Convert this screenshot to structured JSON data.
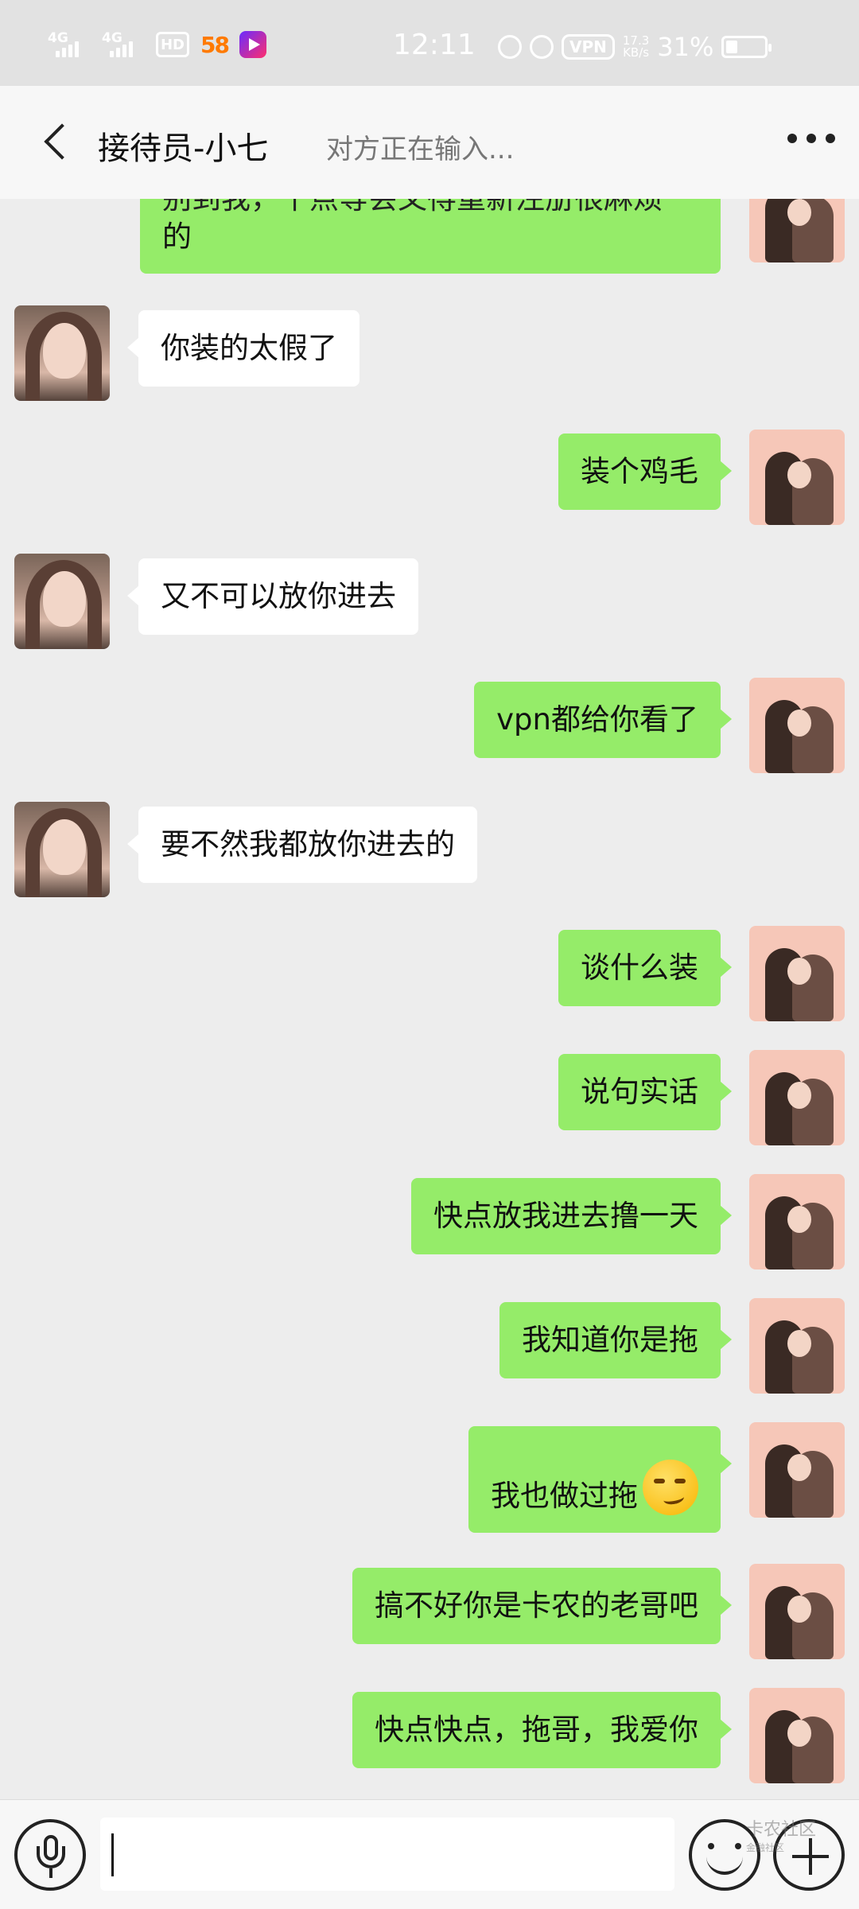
{
  "status_bar": {
    "signal_1": "4G",
    "signal_2": "4G",
    "hd": "HD",
    "app_58": "58",
    "time": "12:11",
    "vpn": "VPN",
    "speed_value": "17.3",
    "speed_unit": "KB/s",
    "battery": "31%",
    "battery_level": 0.31
  },
  "header": {
    "title": "接待员-小七",
    "typing_status": "对方正在输入..."
  },
  "messages": [
    {
      "sender": "me",
      "text": "别到我，十点等会又得重新注册很麻烦的",
      "visible_line_1": "别到我，十点等会又得重新注册很麻烦",
      "visible_line_2": "的"
    },
    {
      "sender": "them",
      "text": "你装的太假了"
    },
    {
      "sender": "me",
      "text": "装个鸡毛"
    },
    {
      "sender": "them",
      "text": "又不可以放你进去"
    },
    {
      "sender": "me",
      "text": "vpn都给你看了"
    },
    {
      "sender": "them",
      "text": "要不然我都放你进去的"
    },
    {
      "sender": "me",
      "text": "谈什么装"
    },
    {
      "sender": "me",
      "text": "说句实话"
    },
    {
      "sender": "me",
      "text": "快点放我进去撸一天"
    },
    {
      "sender": "me",
      "text": "我知道你是拖"
    },
    {
      "sender": "me",
      "text": "我也做过拖",
      "emoji": "smirk-emoji"
    },
    {
      "sender": "me",
      "text": "搞不好你是卡农的老哥吧"
    },
    {
      "sender": "me",
      "text": "快点快点，拖哥，我爱你"
    }
  ],
  "input_bar": {
    "text_value": "",
    "voice_icon": "microphone-icon",
    "emoji_icon": "smiley-icon",
    "plus_icon": "plus-icon"
  },
  "watermark": {
    "text": "卡农社区",
    "subtext": "金融社区"
  },
  "colors": {
    "my_bubble": "#95ec69",
    "their_bubble": "#ffffff",
    "chat_background": "#ededed"
  }
}
